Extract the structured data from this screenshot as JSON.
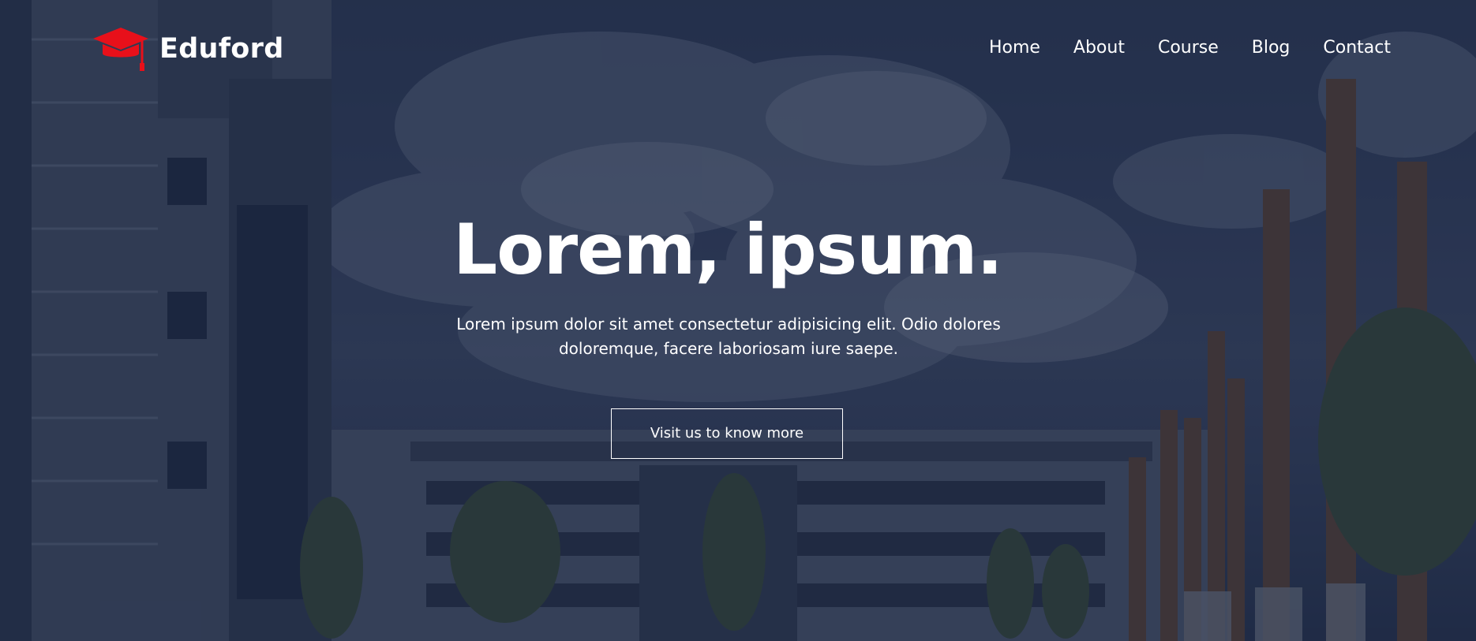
{
  "brand": {
    "name": "Eduford",
    "icon": "graduation-cap-icon",
    "accent": "#e8101a"
  },
  "nav": [
    {
      "label": "Home"
    },
    {
      "label": "About"
    },
    {
      "label": "Course"
    },
    {
      "label": "Blog"
    },
    {
      "label": "Contact"
    }
  ],
  "hero": {
    "headline": "Lorem, ipsum.",
    "subtext": "Lorem ipsum dolor sit amet consectetur adipisicing elit. Odio dolores doloremque, facere laboriosam iure saepe.",
    "cta_label": "Visit us to know more",
    "overlay_color": "#17223e"
  }
}
